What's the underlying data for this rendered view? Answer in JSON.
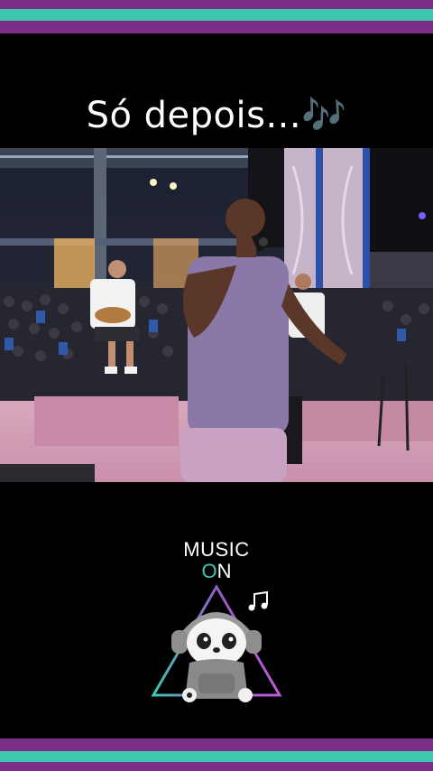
{
  "caption": {
    "text": "Só depois...",
    "notes": "🎶"
  },
  "logo": {
    "line1": "MUSIC",
    "on_prefix": "",
    "on_o": "O",
    "on_suffix": "N"
  },
  "colors": {
    "stripe_purple": "#7b2f86",
    "stripe_teal": "#3fc6b0",
    "background": "#000000"
  }
}
